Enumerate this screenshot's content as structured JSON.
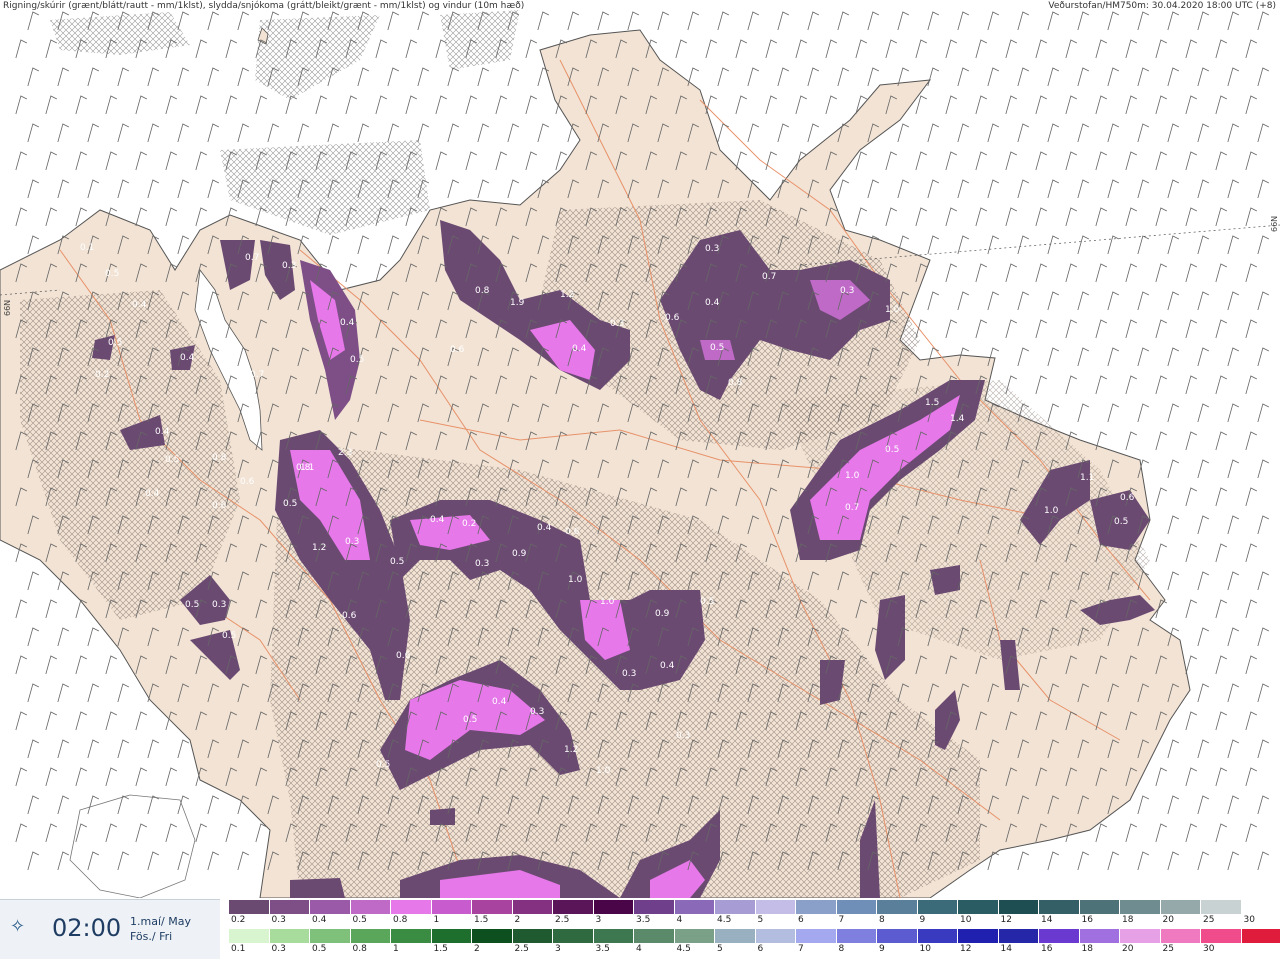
{
  "header": {
    "left": "Rigning/skúrir (grænt/blátt/rautt - mm/1klst), slydda/snjókoma (grátt/bleikt/grænt - mm/1klst) og vindur (10m hæð)",
    "right": "Veðurstofan/HM750m: 30.04.2020 18:00 UTC (+8)"
  },
  "latitude_labels": [
    "66N",
    "66N"
  ],
  "time_panel": {
    "time": "02:00",
    "date_line1": "1.maí/ May",
    "date_line2": "Fös./ Fri",
    "icon": "compass-star-icon"
  },
  "legend": {
    "snow_colors": [
      "#6b4a72",
      "#7d4f86",
      "#9a5aa8",
      "#c06ac8",
      "#e678e9",
      "#c85ccf",
      "#a8439f",
      "#843182",
      "#5a1458",
      "#4a0548",
      "#6f3f8c",
      "#8a6ab8",
      "#a79cd4",
      "#c3bde8",
      "#8aa0c8",
      "#6f8fb8",
      "#5a7f9a",
      "#3b6a78",
      "#2a5c64",
      "#1e4d52",
      "#345f66",
      "#4d7378",
      "#6f8c90",
      "#95a9ab",
      "#c9d2d3",
      "#ffffff"
    ],
    "snow_labels": [
      "0.2",
      "0.3",
      "0.4",
      "0.5",
      "0.8",
      "1",
      "1.5",
      "2",
      "2.5",
      "3",
      "3.5",
      "4",
      "4.5",
      "5",
      "6",
      "7",
      "8",
      "9",
      "10",
      "12",
      "14",
      "16",
      "18",
      "20",
      "25",
      "30"
    ],
    "rain_colors": [
      "#d8f5d0",
      "#a8dc9c",
      "#7fc07a",
      "#5aa65a",
      "#3a8c42",
      "#1e6e2e",
      "#0d4f1f",
      "#1f5a30",
      "#2f6a40",
      "#3e7850",
      "#5a8a6a",
      "#7aa088",
      "#98b0c0",
      "#b3bde0",
      "#a4a8ef",
      "#7f7fe0",
      "#5c5cd0",
      "#3a3ac0",
      "#1f1fb0",
      "#2626a8",
      "#6a3ad0",
      "#a070e0",
      "#e6a0e6",
      "#f07ac0",
      "#f04c8c",
      "#e01c3c"
    ],
    "rain_labels": [
      "0.1",
      "0.3",
      "0.5",
      "0.8",
      "1",
      "1.5",
      "2",
      "2.5",
      "3",
      "3.5",
      "4",
      "4.5",
      "5",
      "6",
      "7",
      "8",
      "9",
      "10",
      "12",
      "14",
      "16",
      "18",
      "20",
      "25",
      "30"
    ]
  },
  "map": {
    "land_color": "#f2e3d4",
    "sea_color": "#ffffff",
    "precip_values": [
      "0.1",
      "0.5",
      "0.4",
      "0.5",
      "0.2",
      "0.7",
      "0.3",
      "0.4",
      "0.5",
      "0.6",
      "0.8",
      "1.9",
      "1.2",
      "0.4",
      "0.3",
      "0.6",
      "0.3",
      "0.4",
      "0.7",
      "0.5",
      "0.8",
      "0.3",
      "1.0",
      "0.7",
      "0.4",
      "0.5",
      "1.1",
      "2.3",
      "1.4",
      "1.5",
      "1.0",
      "0.5",
      "0.7",
      "1.1",
      "0.6",
      "1.0",
      "0.5",
      "0.4",
      "0.8",
      "0.6",
      "0.4",
      "0.6",
      "0.8",
      "0.3",
      "0.5",
      "1.2",
      "0.5",
      "0.4",
      "0.2",
      "0.3",
      "0.4",
      "0.6",
      "0.9",
      "1.0",
      "1.0",
      "0.9",
      "0.5",
      "0.3",
      "0.4",
      "0.5",
      "0.3",
      "0.5",
      "0.6",
      "0.6",
      "0.5",
      "0.5",
      "0.4",
      "0.3",
      "1.2",
      "1.0",
      "0.3"
    ]
  }
}
